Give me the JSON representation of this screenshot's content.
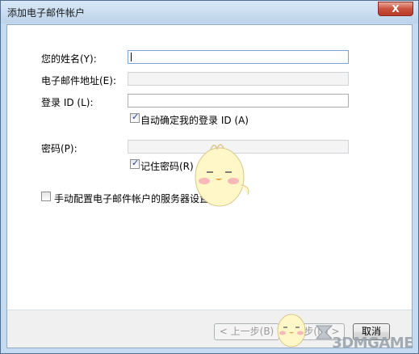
{
  "window": {
    "title": "添加电子邮件帐户",
    "close_label": "X"
  },
  "form": {
    "name_label": "您的姓名(Y):",
    "email_label": "电子邮件地址(E):",
    "login_label": "登录 ID (L):",
    "auto_login_label": "自动确定我的登录 ID (A)",
    "auto_login_checked": true,
    "password_label": "密码(P):",
    "remember_password_label": "记住密码(R)",
    "remember_password_checked": true,
    "manual_config_label": "手动配置电子邮件帐户的服务器设置(C)。",
    "manual_config_checked": false
  },
  "footer": {
    "back_label": "< 上一步(B)",
    "next_label": "下一步(N) >",
    "cancel_label": "取消"
  },
  "watermark": "3DMGAME",
  "icons": {
    "checkbox_mark": "check-icon",
    "mascot": "mascot-icon",
    "watermark_logo": "3dm-logo-icon"
  },
  "colors": {
    "titlebar": "#c4dbf1",
    "close_button": "#c9513d",
    "check_mark": "#1c3f94"
  }
}
